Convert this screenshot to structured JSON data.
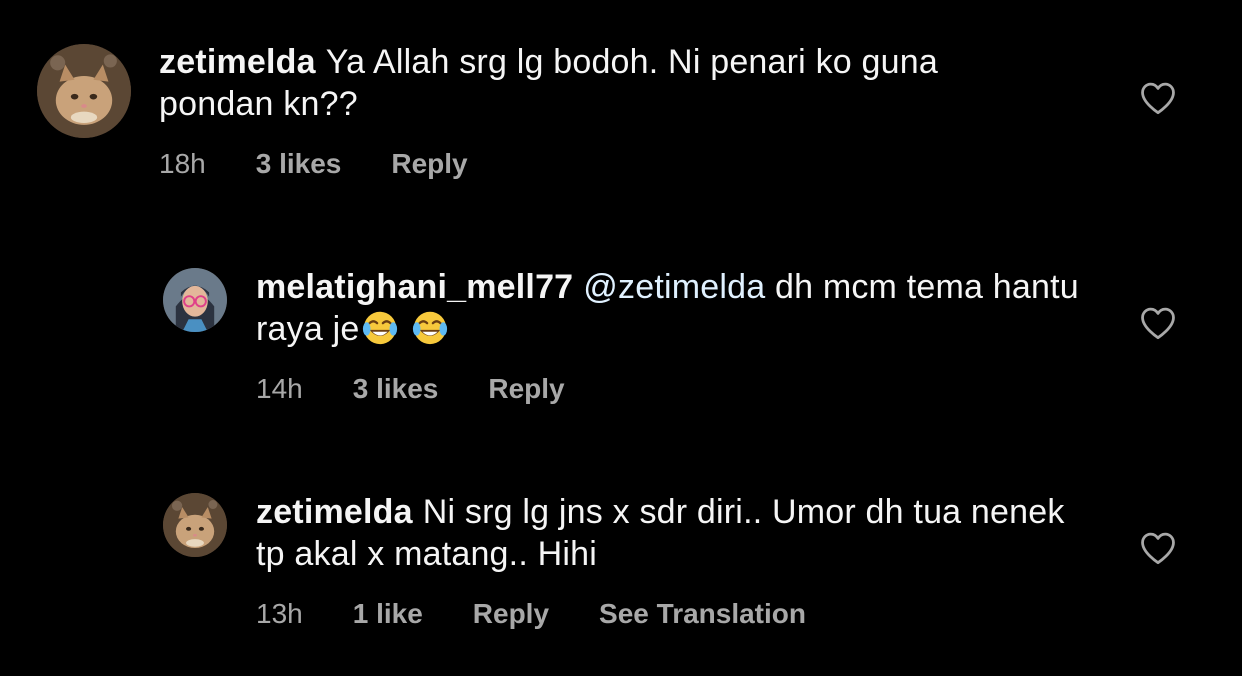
{
  "colors": {
    "background": "#000000",
    "text": "#f5f5f5",
    "meta": "#a8a8a8",
    "mention": "#e0f1ff"
  },
  "comments": [
    {
      "username": "zetimelda",
      "text": "Ya Allah srg lg bodoh. Ni penari ko guna pondan kn??",
      "time": "18h",
      "likes": "3 likes",
      "reply": "Reply",
      "avatar_icon": "cat-avatar-icon",
      "like_icon": "heart-outline-icon"
    },
    {
      "username": "melatighani_mell77",
      "mention": "@zetimelda",
      "text": " dh mcm tema hantu raya je",
      "emojis": [
        "face-with-tears-of-joy-emoji",
        "face-with-tears-of-joy-emoji"
      ],
      "time": "14h",
      "likes": "3 likes",
      "reply": "Reply",
      "avatar_icon": "woman-with-glasses-avatar-icon",
      "like_icon": "heart-outline-icon"
    },
    {
      "username": "zetimelda",
      "text": "Ni srg lg jns x sdr diri.. Umor dh tua nenek tp akal x matang.. Hihi",
      "time": "13h",
      "likes": "1 like",
      "reply": "Reply",
      "see_translation": "See Translation",
      "avatar_icon": "cat-avatar-icon",
      "like_icon": "heart-outline-icon"
    }
  ]
}
